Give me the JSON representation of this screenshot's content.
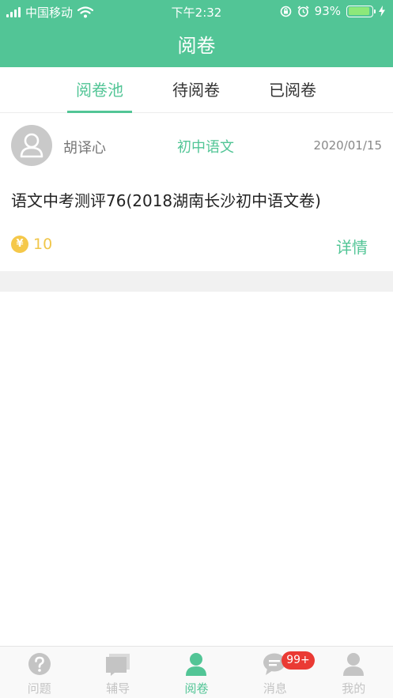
{
  "status_bar": {
    "carrier": "中国移动",
    "time": "下午2:32",
    "battery_percent": "93%",
    "battery_level": 0.93
  },
  "header": {
    "title": "阅卷"
  },
  "tabs": [
    {
      "label": "阅卷池",
      "active": true
    },
    {
      "label": "待阅卷",
      "active": false
    },
    {
      "label": "已阅卷",
      "active": false
    }
  ],
  "card": {
    "author": "胡译心",
    "subject": "初中语文",
    "date": "2020/01/15",
    "title": "语文中考测评76(2018湖南长沙初中语文卷)",
    "coin_symbol": "¥",
    "reward": "10",
    "detail_label": "详情"
  },
  "tabbar": {
    "items": [
      {
        "label": "问题",
        "icon": "question-icon",
        "active": false
      },
      {
        "label": "辅导",
        "icon": "tutor-icon",
        "active": false
      },
      {
        "label": "阅卷",
        "icon": "grading-icon",
        "active": true
      },
      {
        "label": "消息",
        "icon": "message-icon",
        "active": false,
        "badge": "99+"
      },
      {
        "label": "我的",
        "icon": "profile-icon",
        "active": false
      }
    ]
  },
  "colors": {
    "accent": "#52c596",
    "badge": "#ea3a34",
    "coin": "#f5c84a",
    "inactive_tab_icon": "#c4c4c4"
  }
}
